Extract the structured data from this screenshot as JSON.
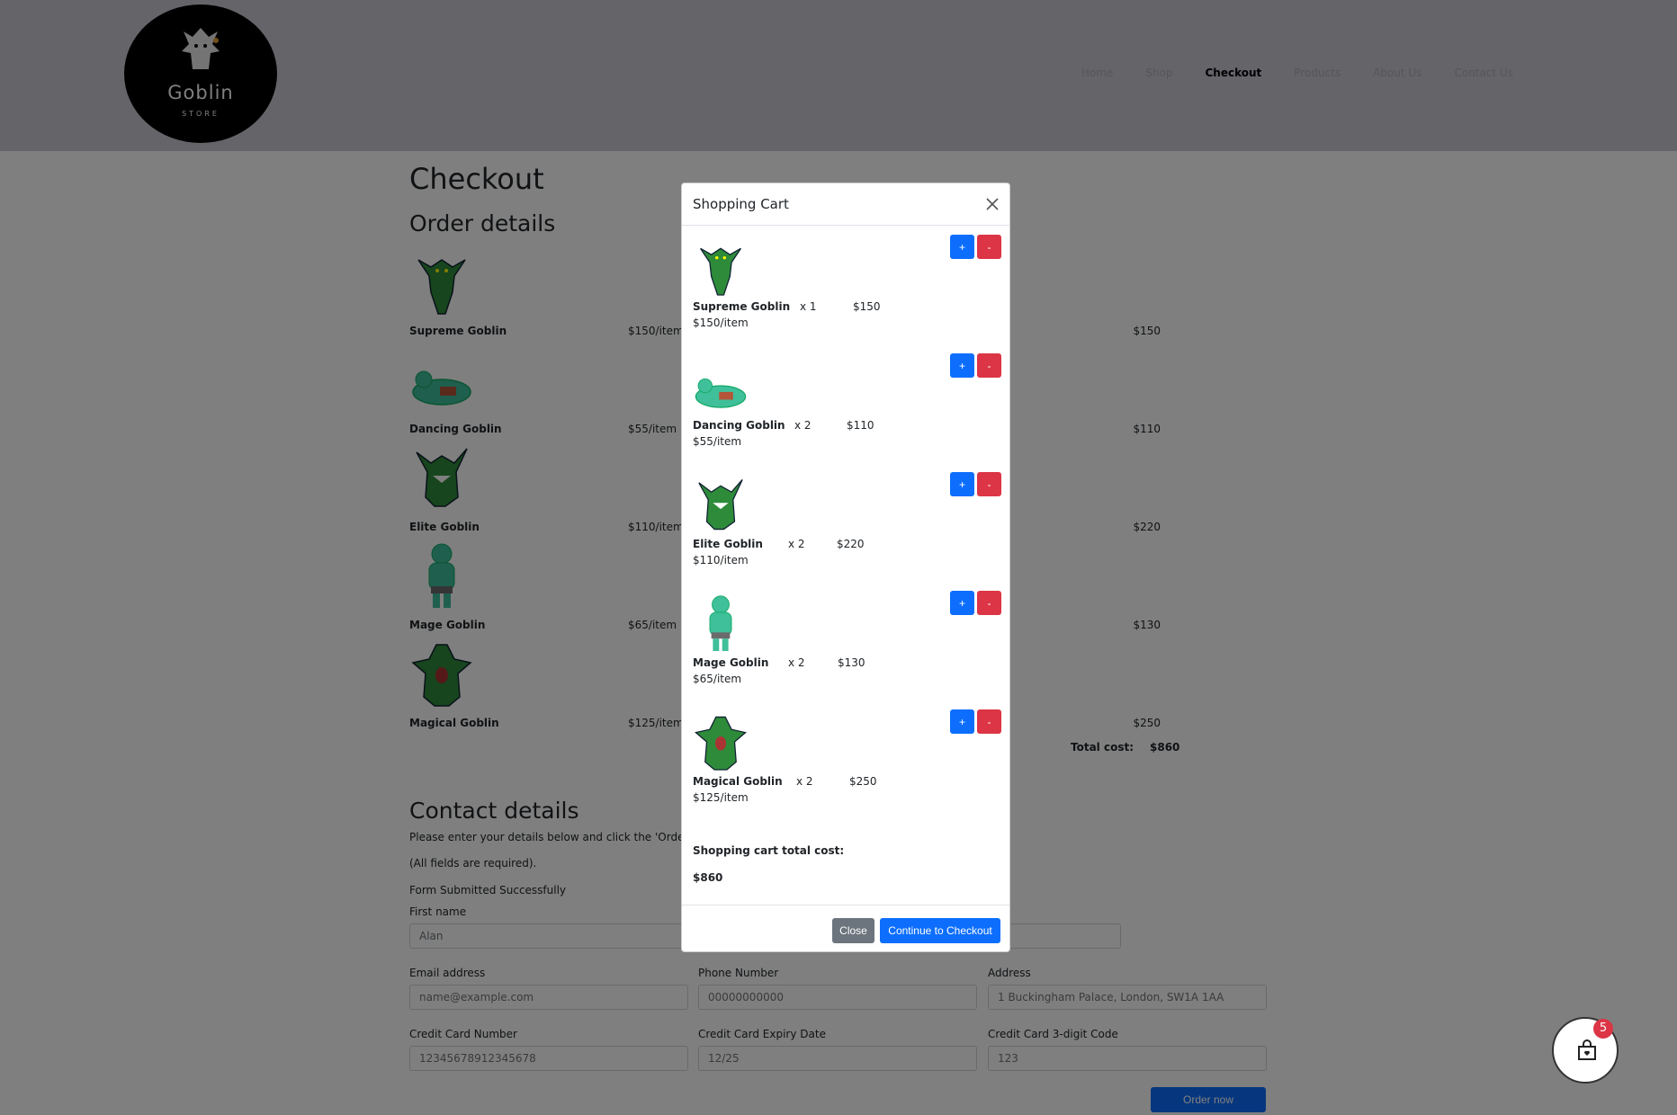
{
  "brand": {
    "name": "Goblin",
    "tagline": "STORE"
  },
  "nav": {
    "items": [
      "Home",
      "Shop",
      "Checkout",
      "Products",
      "About Us",
      "Contact Us"
    ],
    "active": "Checkout"
  },
  "page": {
    "title": "Checkout",
    "order_heading": "Order details",
    "order_items": [
      {
        "name": "Supreme Goblin",
        "unit": "$150/item",
        "total": "$150"
      },
      {
        "name": "Dancing Goblin",
        "unit": "$55/item",
        "total": "$110"
      },
      {
        "name": "Elite Goblin",
        "unit": "$110/item",
        "total": "$220"
      },
      {
        "name": "Mage Goblin",
        "unit": "$65/item",
        "total": "$130"
      },
      {
        "name": "Magical Goblin",
        "unit": "$125/item",
        "total": "$250"
      }
    ],
    "total_label": "Total cost:",
    "total_value": "$860",
    "contact_heading": "Contact details",
    "instructions": "Please enter your details below and click the 'Order now' b",
    "required_note": "(All fields are required).",
    "status": "Form Submitted Successfully",
    "form": {
      "first_name_label": "First name",
      "first_name_value": "Alan",
      "email_label": "Email address",
      "email_placeholder": "name@example.com",
      "phone_label": "Phone Number",
      "phone_placeholder": "00000000000",
      "address_label": "Address",
      "address_placeholder": "1 Buckingham Palace, London, SW1A 1AA",
      "card_label": "Credit Card Number",
      "card_placeholder": "12345678912345678",
      "expiry_label": "Credit Card Expiry Date",
      "expiry_placeholder": "12/25",
      "cvv_label": "Credit Card 3-digit Code",
      "cvv_placeholder": "123"
    },
    "order_button": "Order now"
  },
  "cart_badge": "5",
  "modal": {
    "title": "Shopping Cart",
    "items": [
      {
        "name": "Supreme Goblin",
        "unit": "$150/item",
        "qty": "x 1",
        "subtotal": "$150",
        "plus": "+",
        "minus": "-"
      },
      {
        "name": "Dancing Goblin",
        "unit": "$55/item",
        "qty": "x 2",
        "subtotal": "$110",
        "plus": "+",
        "minus": "-"
      },
      {
        "name": "Elite Goblin",
        "unit": "$110/item",
        "qty": "x 2",
        "subtotal": "$220",
        "plus": "+",
        "minus": "-"
      },
      {
        "name": "Mage Goblin",
        "unit": "$65/item",
        "qty": "x 2",
        "subtotal": "$130",
        "plus": "+",
        "minus": "-"
      },
      {
        "name": "Magical Goblin",
        "unit": "$125/item",
        "qty": "x 2",
        "subtotal": "$250",
        "plus": "+",
        "minus": "-"
      }
    ],
    "total_label": "Shopping cart total cost:",
    "total_value": "$860",
    "close_label": "Close",
    "continue_label": "Continue to Checkout"
  },
  "colors": {
    "primary": "#0d6efd",
    "danger": "#dc3545",
    "secondary": "#6c757d",
    "goblin_green": "#2e8b3a",
    "goblin_teal": "#3fbf9a"
  }
}
